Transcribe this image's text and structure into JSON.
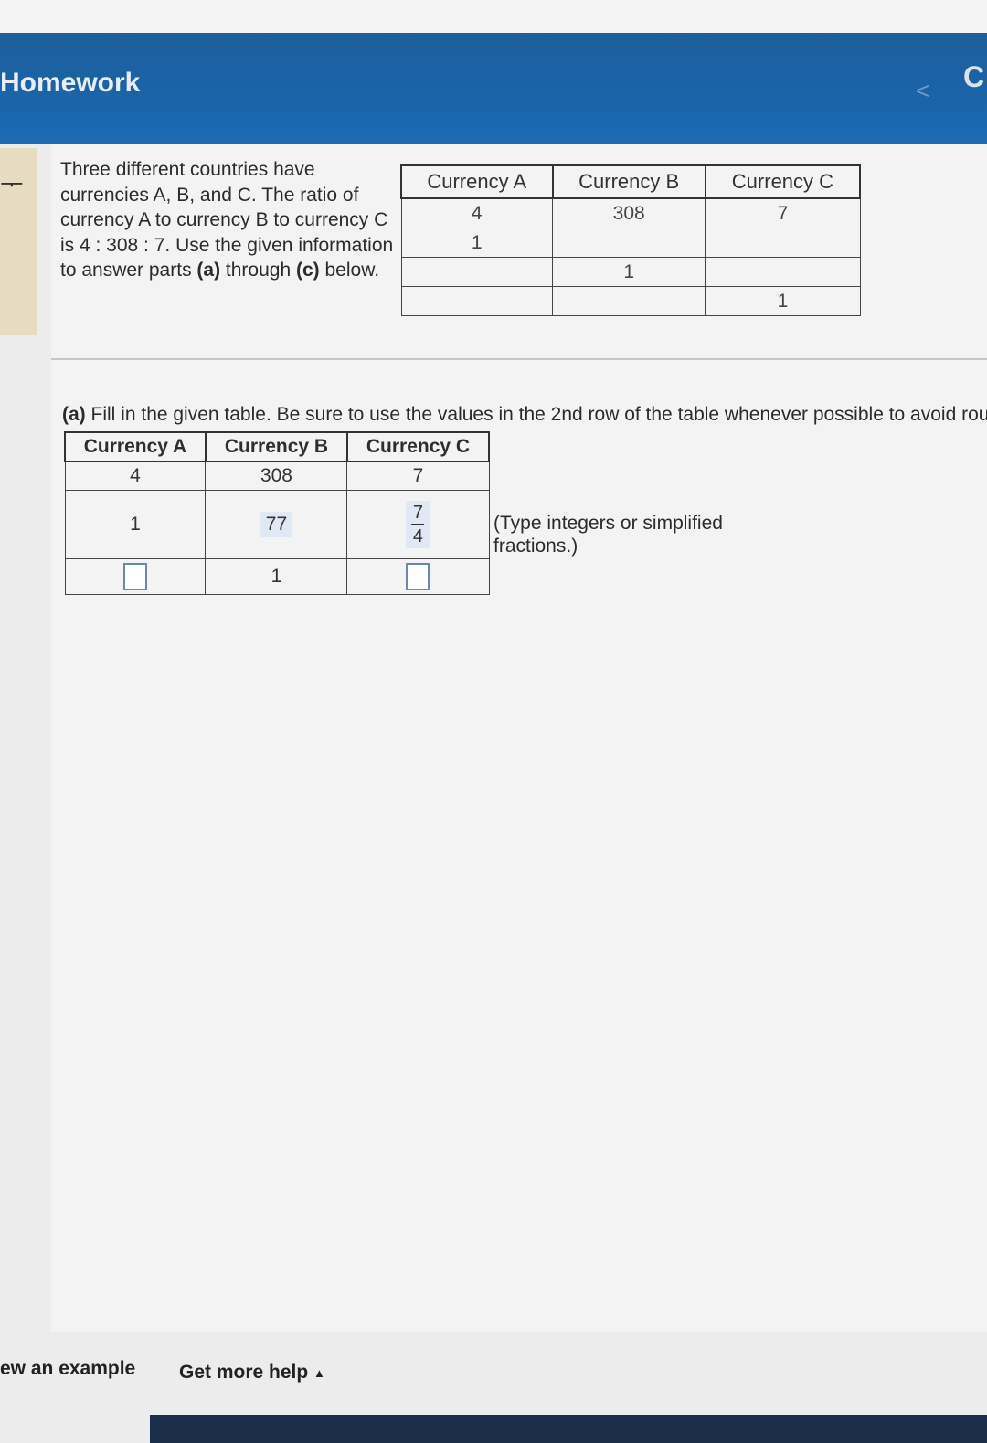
{
  "header": {
    "title": "Homework",
    "back_icon": "<",
    "right_glyph": "C"
  },
  "sidebar": {
    "mark": "ᅮ"
  },
  "problem": {
    "text_before": "Three different countries have currencies A, B, and C. The ratio of currency A to currency B to currency C is 4 : 308 : 7. Use the given information to answer parts ",
    "bold_a": "(a)",
    "text_mid": " through ",
    "bold_c": "(c)",
    "text_after": " below."
  },
  "ref_table": {
    "headers": [
      "Currency A",
      "Currency B",
      "Currency C"
    ],
    "rows": [
      [
        "4",
        "308",
        "7"
      ],
      [
        "1",
        "",
        ""
      ],
      [
        "",
        "1",
        ""
      ],
      [
        "",
        "",
        "1"
      ]
    ]
  },
  "part_a": {
    "label": "(a)",
    "prompt": "Fill in the given table. Be sure to use the values in the 2nd row of the table whenever possible to avoid rou",
    "headers": [
      "Currency A",
      "Currency B",
      "Currency C"
    ],
    "row0": [
      "4",
      "308",
      "7"
    ],
    "row1": {
      "a": "1",
      "b": "77",
      "c_num": "7",
      "c_den": "4"
    },
    "row2": {
      "b": "1"
    },
    "hint": "(Type integers or simplified fractions.)"
  },
  "footer": {
    "example": "ew an example",
    "help": "Get more help",
    "help_caret": "▲"
  }
}
